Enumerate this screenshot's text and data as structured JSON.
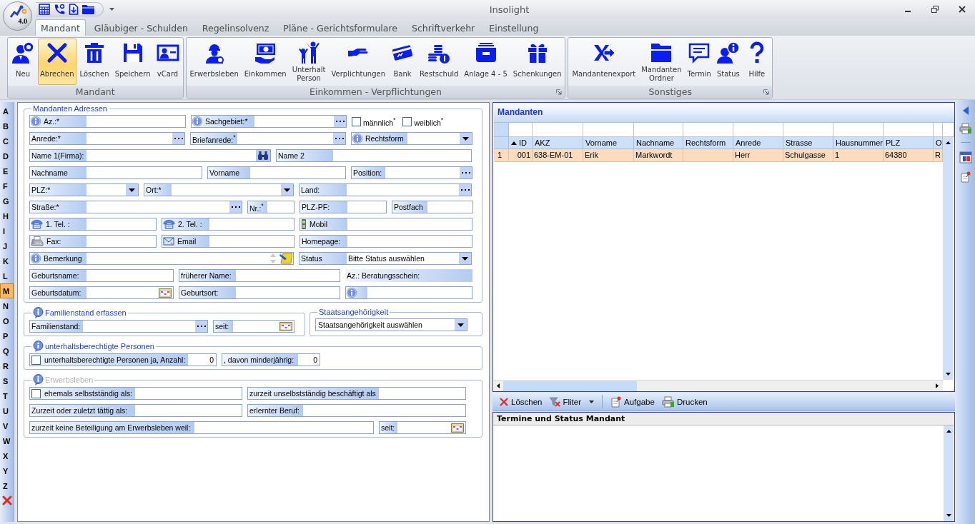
{
  "window": {
    "title": "Insolight",
    "version": "4.0"
  },
  "ribbon": {
    "tabs": [
      {
        "label": "Mandant",
        "selected": true
      },
      {
        "label": "Gläubiger - Schulden",
        "selected": false
      },
      {
        "label": "Regelinsolvenz",
        "selected": false
      },
      {
        "label": "Pläne - Gerichtsformulare",
        "selected": false
      },
      {
        "label": "Schriftverkehr",
        "selected": false
      },
      {
        "label": "Einstellung",
        "selected": false
      }
    ],
    "groups": [
      {
        "label": "Mandant",
        "launcher": false,
        "buttons": [
          {
            "label": "Neu",
            "highlighted": false
          },
          {
            "label": "Abrechen",
            "highlighted": true
          },
          {
            "label": "Löschen",
            "highlighted": false
          },
          {
            "label": "Speichern",
            "highlighted": false
          },
          {
            "label": "vCard",
            "highlighted": false
          }
        ]
      },
      {
        "label": "Einkommen - Verpflichtungen",
        "launcher": true,
        "buttons": [
          {
            "label": "Erwerbsleben",
            "highlighted": false
          },
          {
            "label": "Einkommen",
            "highlighted": false
          },
          {
            "label": "Unterhalt\nPerson",
            "highlighted": false
          },
          {
            "label": "Verplichtungen",
            "highlighted": false
          },
          {
            "label": "Bank",
            "highlighted": false
          },
          {
            "label": "Restschuld",
            "highlighted": false
          },
          {
            "label": "Anlage 4 - 5",
            "highlighted": false
          },
          {
            "label": "Schenkungen",
            "highlighted": false
          }
        ]
      },
      {
        "label": "Sonstiges",
        "launcher": true,
        "buttons": [
          {
            "label": "Mandantenexport",
            "highlighted": false
          },
          {
            "label": "Mandanten\nOrdner",
            "highlighted": false
          },
          {
            "label": "Termin",
            "highlighted": false
          },
          {
            "label": "Status",
            "highlighted": false
          },
          {
            "label": "Hilfe",
            "highlighted": false
          }
        ]
      }
    ]
  },
  "alphabet": [
    {
      "label": "A",
      "selected": false
    },
    {
      "label": "B",
      "selected": false
    },
    {
      "label": "C",
      "selected": false
    },
    {
      "label": "D",
      "selected": false
    },
    {
      "label": "E",
      "selected": false
    },
    {
      "label": "F",
      "selected": false
    },
    {
      "label": "G",
      "selected": false
    },
    {
      "label": "H",
      "selected": false
    },
    {
      "label": "I",
      "selected": false
    },
    {
      "label": "J",
      "selected": false
    },
    {
      "label": "K",
      "selected": false
    },
    {
      "label": "L",
      "selected": false
    },
    {
      "label": "M",
      "selected": true
    },
    {
      "label": "N",
      "selected": false
    },
    {
      "label": "O",
      "selected": false
    },
    {
      "label": "P",
      "selected": false
    },
    {
      "label": "Q",
      "selected": false
    },
    {
      "label": "R",
      "selected": false
    },
    {
      "label": "S",
      "selected": false
    },
    {
      "label": "T",
      "selected": false
    },
    {
      "label": "U",
      "selected": false
    },
    {
      "label": "V",
      "selected": false
    },
    {
      "label": "W",
      "selected": false
    },
    {
      "label": "X",
      "selected": false
    },
    {
      "label": "Y",
      "selected": false
    },
    {
      "label": "Z",
      "selected": false
    }
  ],
  "form": {
    "sections": [
      {
        "legend": "Mandanten Adressen",
        "kind": "plain",
        "disabled": false,
        "rows": [
          [
            {
              "kind": "info",
              "label": "Az.:*"
            },
            {
              "kind": "infolookup",
              "label": "Sachgebiet:*"
            },
            {
              "kind": "check",
              "label": "männlich$^{*}$",
              "checked": false
            },
            {
              "kind": "check",
              "label": "weiblich$^{*}$",
              "checked": false
            }
          ],
          [
            {
              "kind": "lookup",
              "label": "Anrede:*"
            },
            {
              "kind": "lookup",
              "label": "Briefanrede:$^{*}$"
            },
            {
              "kind": "infocombo",
              "label": "Rechtsform"
            }
          ],
          [
            {
              "kind": "search",
              "label": "Name 1(Firma):"
            },
            {
              "kind": "text",
              "label": "Name 2"
            }
          ],
          [
            {
              "kind": "text",
              "label": "Nachname"
            },
            {
              "kind": "text",
              "label": "Vorname"
            },
            {
              "kind": "lookup",
              "label": "Position:"
            }
          ],
          [
            {
              "kind": "combo",
              "label": "PLZ:*"
            },
            {
              "kind": "combo",
              "label": "Ort:*"
            },
            {
              "kind": "lookup",
              "label": "Land:"
            }
          ],
          [
            {
              "kind": "lookup",
              "label": "Straße:*"
            },
            {
              "kind": "text",
              "label": "Nr.:$^{*}$"
            },
            {
              "kind": "text",
              "label": "PLZ-PF:"
            },
            {
              "kind": "text",
              "label": "Postfach"
            }
          ],
          [
            {
              "kind": "phone",
              "label": "1. Tel. :"
            },
            {
              "kind": "phone",
              "label": "2. Tel. :"
            },
            {
              "kind": "mobile",
              "label": "Mobil"
            }
          ],
          [
            {
              "kind": "fax",
              "label": "Fax:"
            },
            {
              "kind": "email",
              "label": "Email"
            },
            {
              "kind": "text",
              "label": "Homepage:"
            }
          ],
          [
            {
              "kind": "memo",
              "label": "Bemerkung"
            },
            {
              "kind": "combo",
              "label": "Status",
              "value": "Bitte Status auswählen"
            }
          ],
          [
            {
              "kind": "text",
              "label": "Geburtsname:"
            },
            {
              "kind": "text",
              "label": "früherer Name:"
            },
            {
              "kind": "caption",
              "label": "Az.: Beratungsschein:"
            }
          ],
          [
            {
              "kind": "date",
              "label": "Geburtsdatum:"
            },
            {
              "kind": "text",
              "label": "Geburtsort:"
            },
            {
              "kind": "info"
            }
          ]
        ]
      },
      {
        "legend": "Familienstand erfassen",
        "kind": "info",
        "disabled": false,
        "rows": [
          [
            {
              "kind": "lookup",
              "label": "Familienstand:"
            },
            {
              "kind": "date",
              "label": "seit:"
            }
          ]
        ]
      },
      {
        "legend": "Staatsangehörigkeit",
        "kind": "plain",
        "disabled": false,
        "rows": [
          [
            {
              "kind": "combo",
              "value": "Staatsangehörigkeit auswählen"
            }
          ]
        ]
      },
      {
        "legend": "unterhaltsberechtigte Personen",
        "kind": "info",
        "disabled": false,
        "rows": [
          [
            {
              "kind": "checkfield",
              "label": "unterhaltsberechtigte Personen ja, Anzahl:",
              "checked": false,
              "value": "0"
            },
            {
              "kind": "text",
              "label": ", davon minderjährig:",
              "value": "0"
            }
          ]
        ]
      },
      {
        "legend": "Erwerbsleben",
        "kind": "info",
        "disabled": true,
        "rows": [
          [
            {
              "kind": "checkfield",
              "label": "ehemals selbstständig als:",
              "checked": false
            },
            {
              "kind": "text",
              "label": "zurzeit unselbstständig beschäftigt als"
            }
          ],
          [
            {
              "kind": "text",
              "label": "Zurzeit oder zuletzt tättig als:"
            },
            {
              "kind": "text",
              "label": "erlernter Beruf:"
            }
          ],
          [
            {
              "kind": "text",
              "label": "zurzeit keine Beteiligung am Erwerbsleben weil:"
            },
            {
              "kind": "date",
              "label": "seit:"
            }
          ]
        ]
      }
    ]
  },
  "clients_grid": {
    "title": "Mandanten",
    "columns": [
      {
        "label": "ID",
        "sorted": true
      },
      {
        "label": "AKZ",
        "sorted": false
      },
      {
        "label": "Vorname",
        "sorted": false
      },
      {
        "label": "Nachname",
        "sorted": false
      },
      {
        "label": "Rechtsform",
        "sorted": false
      },
      {
        "label": "Anrede",
        "sorted": false
      },
      {
        "label": "Strasse",
        "sorted": false
      },
      {
        "label": "Hausnummer",
        "sorted": false
      },
      {
        "label": "PLZ",
        "sorted": false
      },
      {
        "label": "O",
        "sorted": false
      }
    ],
    "rows": [
      {
        "number": "1",
        "selected": true,
        "cells": [
          "001",
          "638-EM-01",
          "Erik",
          "Markwordt",
          null,
          "Herr",
          "Schulgasse",
          "1",
          "64380",
          "R"
        ]
      }
    ]
  },
  "toolbar": [
    [
      {
        "kind": "button",
        "label": "Löschen"
      },
      {
        "kind": "menu",
        "label": "Fliter"
      }
    ],
    [
      {
        "kind": "button",
        "label": "Aufgabe"
      },
      {
        "kind": "button",
        "label": "Drucken"
      }
    ]
  ],
  "appointments_panel": {
    "title": "Termine und Status Mandant"
  }
}
